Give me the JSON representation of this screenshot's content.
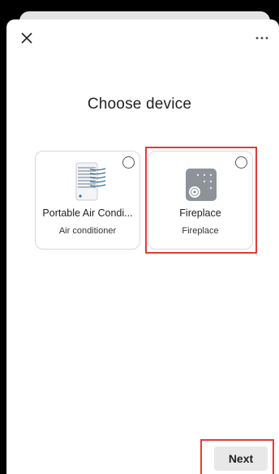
{
  "header": {
    "close_icon": "close-icon",
    "more_icon": "more-options-icon"
  },
  "title": "Choose device",
  "devices": [
    {
      "name": "Portable Air Condi...",
      "type": "Air conditioner",
      "icon": "air-conditioner-icon",
      "selected": false
    },
    {
      "name": "Fireplace",
      "type": "Fireplace",
      "icon": "fireplace-icon",
      "selected": false
    }
  ],
  "footer": {
    "next_label": "Next"
  },
  "colors": {
    "highlight": "#e53935",
    "button_bg": "#e8e8e8",
    "icon_blue": "#2e6da4"
  }
}
